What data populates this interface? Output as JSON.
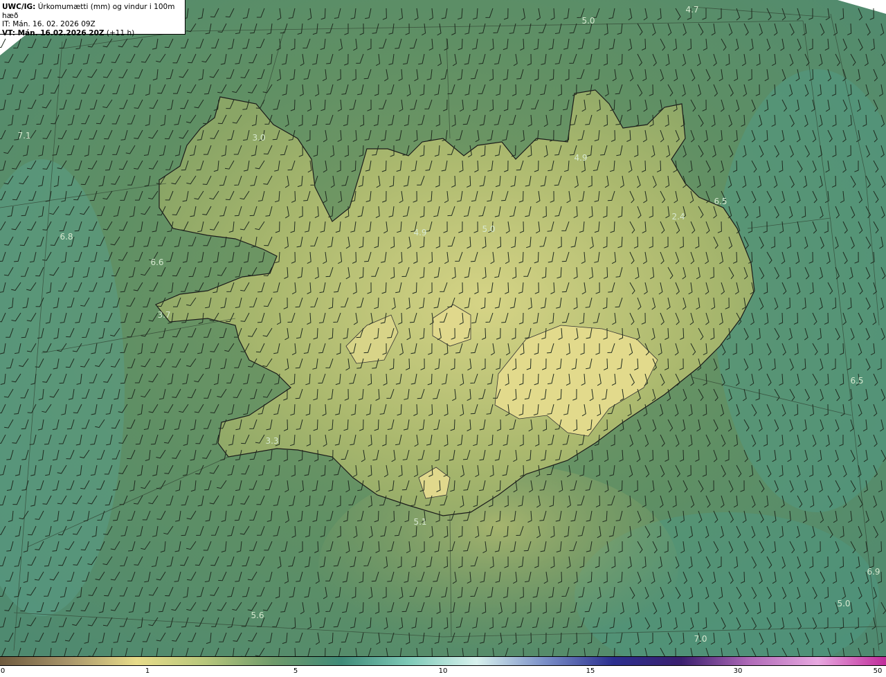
{
  "header": {
    "title_bold": "UWC/IG:",
    "title_rest": " Úrkomumætti (mm) og vindur i 100m hæð",
    "initial_time": "IT: Mán. 16. 02. 2026 09Z",
    "valid_time_bold": "VT: Mán. 16.02.2026 20Z",
    "valid_time_rest": " (+11 h)"
  },
  "map_labels": [
    {
      "id": "nw-sea",
      "text": "7.1"
    },
    {
      "id": "westfjords",
      "text": "3.0"
    },
    {
      "id": "north-sea-1",
      "text": "5.0"
    },
    {
      "id": "north-sea-2",
      "text": "4.7"
    },
    {
      "id": "northeast",
      "text": "4.9"
    },
    {
      "id": "east-coast",
      "text": "6.5"
    },
    {
      "id": "east-highland",
      "text": "2.4"
    },
    {
      "id": "north-central-1",
      "text": "4.9"
    },
    {
      "id": "north-central-2",
      "text": "5.0"
    },
    {
      "id": "west-sea-1",
      "text": "6.8"
    },
    {
      "id": "west-sea-2",
      "text": "6.6"
    },
    {
      "id": "snaefellsnes",
      "text": "3.7"
    },
    {
      "id": "east-sea",
      "text": "6.5"
    },
    {
      "id": "reykjanes",
      "text": "3.3"
    },
    {
      "id": "south-coast",
      "text": "5.1"
    },
    {
      "id": "southeast-sea",
      "text": "6.9"
    },
    {
      "id": "south-sea-1",
      "text": "5.6"
    },
    {
      "id": "south-sea-2",
      "text": "5.0"
    },
    {
      "id": "south-sea-3",
      "text": "7.0"
    }
  ],
  "colorbar": {
    "ticks": [
      "0",
      "1",
      "5",
      "10",
      "15",
      "30",
      "50"
    ],
    "colors": [
      "#6e5a3e",
      "#a8956a",
      "#e8dc8a",
      "#b8c77c",
      "#6f9a6a",
      "#3f8a78",
      "#7fcab8",
      "#d8f2ee",
      "#7a8fc8",
      "#2c2f8f",
      "#3a1f6e",
      "#b06ab8",
      "#e8a8e0",
      "#c02c9a"
    ]
  }
}
